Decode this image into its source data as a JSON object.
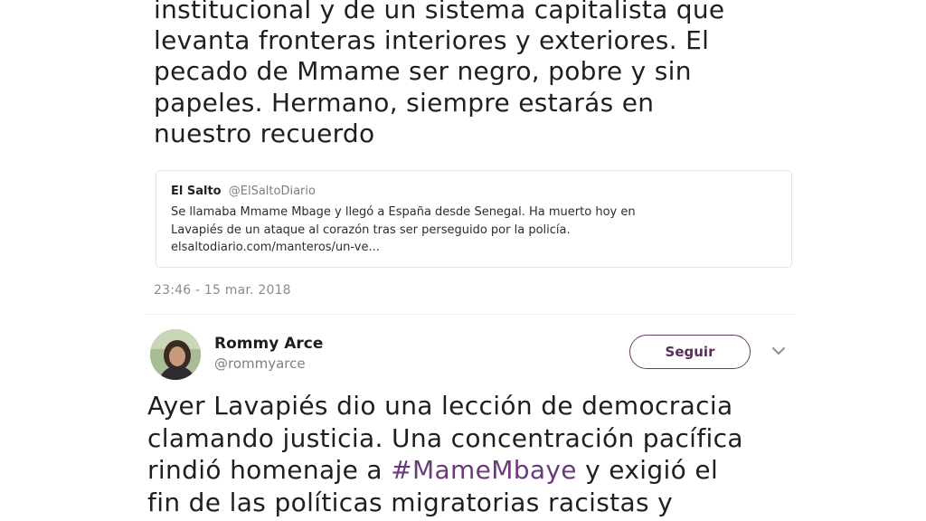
{
  "tweet_top": {
    "text_lines": [
      "institucional y de un sistema capitalista que",
      "levanta fronteras interiores y exteriores. El",
      "pecado de Mmame ser negro, pobre y sin",
      "papeles. Hermano, siempre estarás en",
      "nuestro recuerdo"
    ],
    "quoted": {
      "name": "El Salto",
      "handle": "@ElSaltoDiario",
      "text_lines": [
        "Se llamaba Mmame Mbage y llegó a España desde Senegal. Ha muerto hoy en",
        "Lavapiés de un ataque al corazón tras ser perseguido por la policía.",
        "elsaltodiario.com/manteros/un-ve..."
      ]
    },
    "timestamp": "23:46 - 15 mar. 2018"
  },
  "tweet_second": {
    "author_name": "Rommy Arce",
    "author_handle": "@rommyarce",
    "follow_label": "Seguir",
    "menu_icon": "chevron-down-icon",
    "text_line1": "Ayer Lavapiés dio una lección de democracia",
    "text_line2": "clamando justicia. Una concentración pacífica",
    "text_line3_pre": "rindió homenaje a ",
    "hashtag": "#MameMbaye",
    "text_line3_post": " y exigió el",
    "text_line4": "fin de las políticas migratorias racistas y"
  },
  "colors": {
    "follow_accent": "#6b3b69",
    "hashtag": "#6a3b77",
    "muted_text": "#7a8087"
  }
}
